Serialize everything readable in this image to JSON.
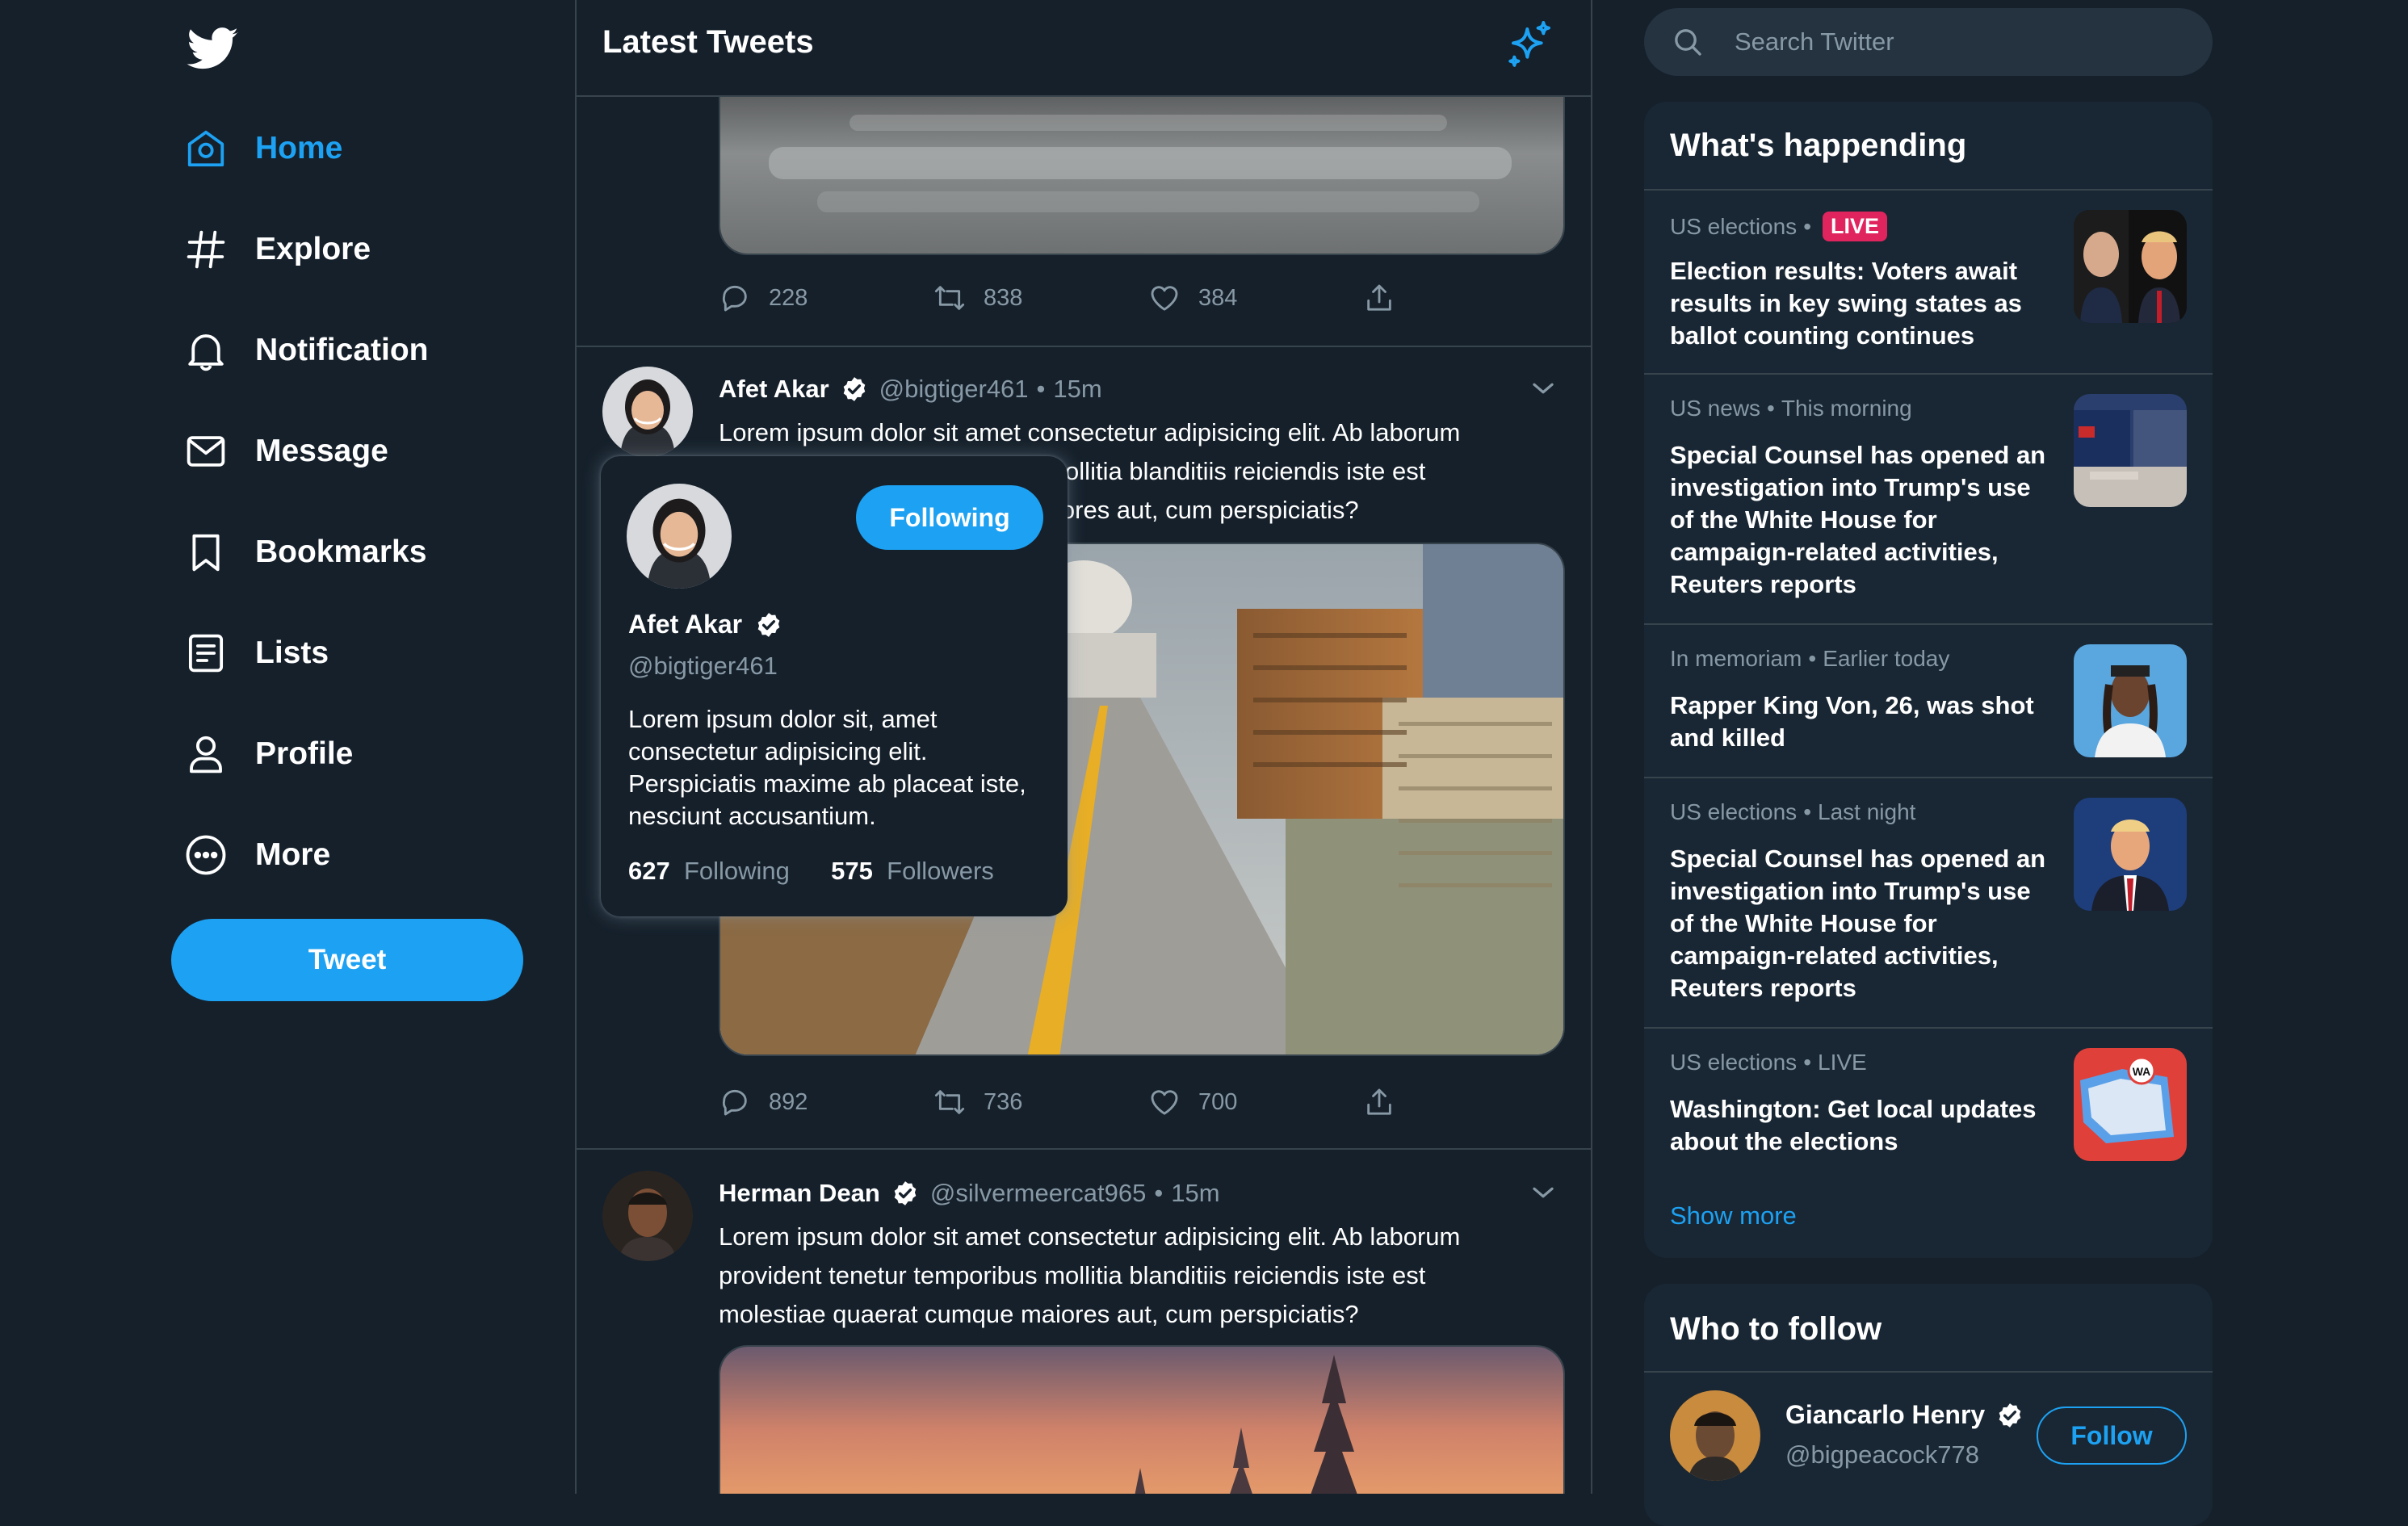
{
  "colors": {
    "accent": "#1da1f2",
    "background": "#15202b",
    "panel": "#192734",
    "muted": "#8899a6",
    "live": "#e0245e"
  },
  "sidebar": {
    "logo_icon": "twitter-bird-icon",
    "items": [
      {
        "label": "Home",
        "icon": "home-icon",
        "active": true
      },
      {
        "label": "Explore",
        "icon": "hashtag-icon"
      },
      {
        "label": "Notification",
        "icon": "bell-icon"
      },
      {
        "label": "Message",
        "icon": "envelope-icon"
      },
      {
        "label": "Bookmarks",
        "icon": "bookmark-icon"
      },
      {
        "label": "Lists",
        "icon": "list-icon"
      },
      {
        "label": "Profile",
        "icon": "person-icon"
      },
      {
        "label": "More",
        "icon": "more-circle-icon"
      }
    ],
    "tweet_button": "Tweet"
  },
  "feed": {
    "title": "Latest Tweets",
    "tweets": [
      {
        "actions": {
          "replies": "228",
          "retweets": "838",
          "likes": "384"
        }
      },
      {
        "name": "Afet Akar",
        "handle": "@bigtiger461",
        "separator": "•",
        "time": "15m",
        "text": "Lorem ipsum dolor sit amet consectetur adipisicing elit. Ab laborum provident tenetur temporibus mollitia blanditiis reiciendis iste est molestiae quaerat cumque maiores aut, cum perspiciatis?",
        "actions": {
          "replies": "892",
          "retweets": "736",
          "likes": "700"
        }
      },
      {
        "name": "Herman Dean",
        "handle": "@silvermeercat965",
        "separator": "•",
        "time": "15m",
        "text": "Lorem ipsum dolor sit amet consectetur adipisicing elit. Ab laborum provident tenetur temporibus mollitia blanditiis reiciendis iste est molestiae quaerat cumque maiores aut, cum perspiciatis?"
      }
    ]
  },
  "hover_card": {
    "name": "Afet Akar",
    "handle": "@bigtiger461",
    "button": "Following",
    "bio": "Lorem ipsum dolor sit, amet consectetur adipisicing elit. Perspiciatis maxime ab placeat iste, nesciunt accusantium.",
    "following_count": "627",
    "following_label": "Following",
    "followers_count": "575",
    "followers_label": "Followers"
  },
  "search": {
    "placeholder": "Search Twitter"
  },
  "trends": {
    "title": "What's happending",
    "items": [
      {
        "category": "US elections",
        "sep": "•",
        "badge": "LIVE",
        "title": "Election results: Voters await results in key swing states as ballot counting continues"
      },
      {
        "category": "US news",
        "sep": "•",
        "when": "This morning",
        "title": "Special Counsel has opened an investigation into Trump's use of the White House for campaign-related activities, Reuters reports"
      },
      {
        "category": "In memoriam",
        "sep": "•",
        "when": "Earlier today",
        "title": "Rapper King Von, 26, was shot and killed"
      },
      {
        "category": "US elections",
        "sep": "•",
        "when": "Last night",
        "title": "Special Counsel has opened an investigation into Trump's use of the White House for campaign-related activities, Reuters reports"
      },
      {
        "category": "US elections",
        "sep": "•",
        "when": "LIVE",
        "title": "Washington: Get local updates about the elections",
        "map_label": "WA"
      }
    ],
    "show_more": "Show more"
  },
  "who_to_follow": {
    "title": "Who to follow",
    "users": [
      {
        "name": "Giancarlo Henry",
        "handle": "@bigpeacock778",
        "button": "Follow"
      }
    ]
  }
}
